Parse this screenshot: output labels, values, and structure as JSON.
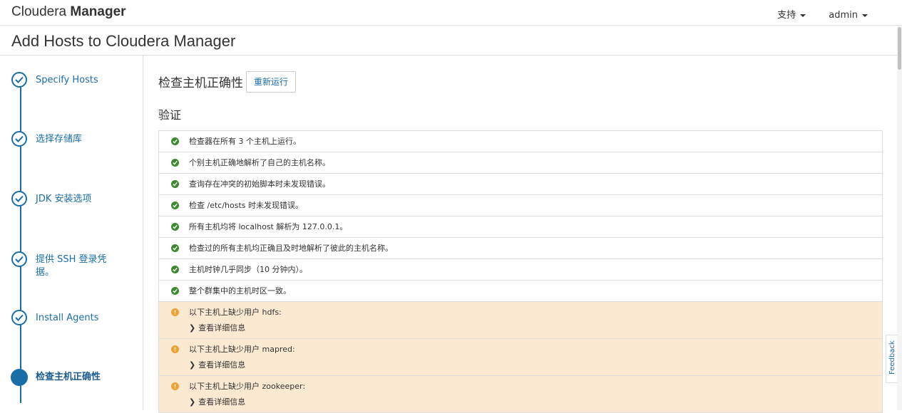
{
  "topbar": {
    "brand_light": "Cloudera",
    "brand_bold": "Manager",
    "support_label": "支持",
    "user_label": "admin"
  },
  "page": {
    "title": "Add Hosts to Cloudera Manager"
  },
  "steps": [
    {
      "label": "Specify Hosts",
      "state": "done"
    },
    {
      "label": "选择存储库",
      "state": "done"
    },
    {
      "label": "JDK 安装选项",
      "state": "done"
    },
    {
      "label": "提供 SSH 登录凭据。",
      "state": "done"
    },
    {
      "label": "Install Agents",
      "state": "done"
    },
    {
      "label": "检查主机正确性",
      "state": "active"
    }
  ],
  "main": {
    "heading": "检查主机正确性",
    "rerun_label": "重新运行",
    "section_title": "验证"
  },
  "results": [
    {
      "status": "ok",
      "text": "检查器在所有 3 个主机上运行。"
    },
    {
      "status": "ok",
      "text": "个别主机正确地解析了自己的主机名称。"
    },
    {
      "status": "ok",
      "text": "查询存在冲突的初始脚本时未发现错误。"
    },
    {
      "status": "ok",
      "text": "检查 /etc/hosts 时未发现错误。"
    },
    {
      "status": "ok",
      "text": "所有主机均将 localhost 解析为 127.0.0.1。"
    },
    {
      "status": "ok",
      "text": "检查过的所有主机均正确且及时地解析了彼此的主机名称。"
    },
    {
      "status": "ok",
      "text": "主机时钟几乎同步（10 分钟内）。"
    },
    {
      "status": "ok",
      "text": "整个群集中的主机时区一致。"
    },
    {
      "status": "warn",
      "text": "以下主机上缺少用户 hdfs:",
      "detail": "查看详细信息"
    },
    {
      "status": "warn",
      "text": "以下主机上缺少用户 mapred:",
      "detail": "查看详细信息"
    },
    {
      "status": "warn",
      "text": "以下主机上缺少用户 zookeeper:",
      "detail": "查看详细信息"
    }
  ],
  "feedback_label": "Feedback",
  "colors": {
    "accent": "#1a6ea8",
    "ok": "#3c8a2e",
    "warn": "#f0a030",
    "warn_bg": "#fbe9d2"
  }
}
